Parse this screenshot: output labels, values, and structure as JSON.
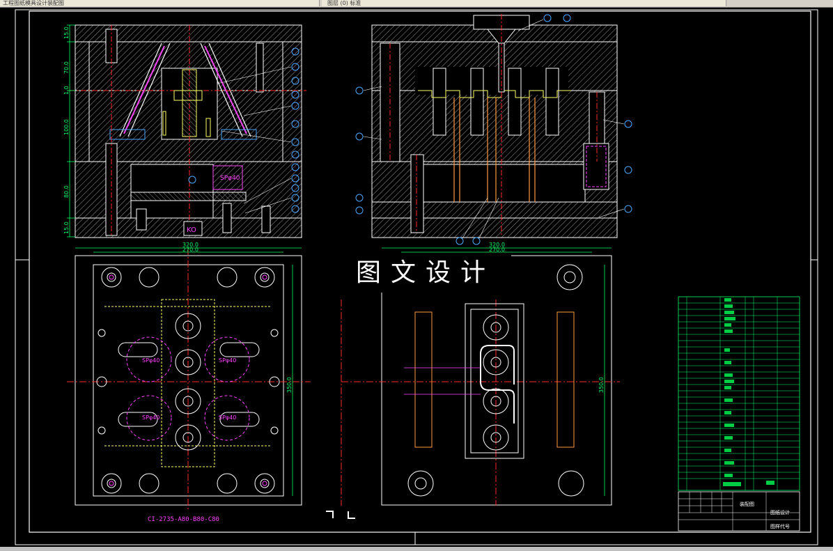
{
  "toolbar": {
    "left_text": "工程图纸模具设计装配图",
    "right_text": "图层 (0) 标准"
  },
  "watermark": "图文设计",
  "part_code": "CI-2735-A80-B80-C80",
  "dimensions": {
    "left_height_segments": [
      "15.0",
      "70.0",
      "1.0",
      "100.0",
      "80.0",
      "15.0"
    ],
    "top_width_outer": "320.0",
    "top_width_inner": "270.0",
    "top_width_outer_right": "320.0",
    "top_width_inner_right": "270.0",
    "plan_height_left": "350.0",
    "plan_height_right": "350.0"
  },
  "labels": {
    "sp40": "SPφ40",
    "ko": "KO"
  },
  "title_block": {
    "title": "装配图",
    "company": "图纸设计",
    "drawing_no": "图样代号"
  },
  "colors": {
    "background": "#000000",
    "frame": "#ffffff",
    "hatch": "#b0b0b0",
    "center_line": "#ff2a2a",
    "dimension": "#00ff66",
    "magenta": "#ff44ff",
    "yellow": "#ffff66",
    "cyan": "#4aa8ff",
    "orange": "#ff9a3c"
  }
}
